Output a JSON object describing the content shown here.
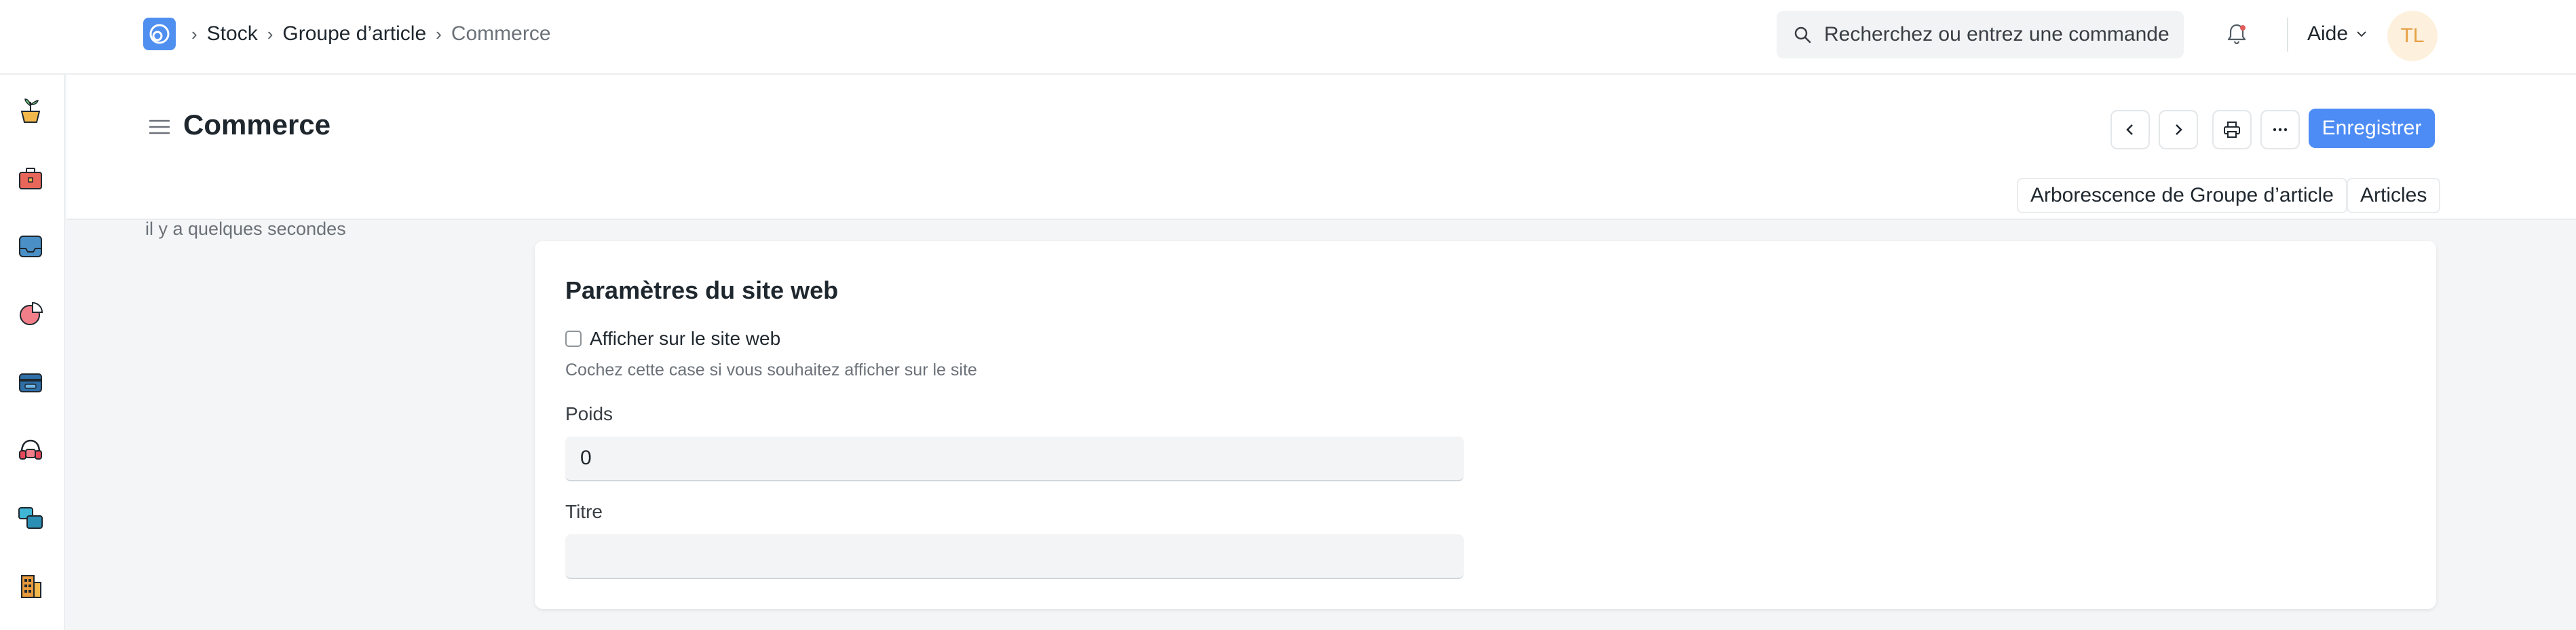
{
  "navbar": {
    "logo": "app-logo",
    "breadcrumb": [
      "Stock",
      "Groupe d’article",
      "Commerce"
    ],
    "search_placeholder": "Recherchez ou entrez une commande",
    "help_label": "Aide",
    "avatar_initials": "TL"
  },
  "sidebar": {
    "icons": [
      "plant-icon",
      "toolbox-icon",
      "inbox-icon",
      "pie-chart-icon",
      "wallet-icon",
      "headset-icon",
      "stack-icon",
      "building-icon"
    ]
  },
  "page": {
    "title": "Commerce",
    "save_label": "Enregistrer",
    "links": [
      "Arborescence de Groupe d’article",
      "Articles"
    ],
    "timestamp": "il y a quelques secondes"
  },
  "section": {
    "title": "Paramètres du site web",
    "checkbox_label": "Afficher sur le site web",
    "checkbox_checked": false,
    "checkbox_description": "Cochez cette case si vous souhaitez afficher sur le site",
    "fields": [
      {
        "label": "Poids",
        "value": "0"
      },
      {
        "label": "Titre",
        "value": ""
      }
    ]
  },
  "colors": {
    "primary": "#4d8cf5",
    "avatar_bg": "#fdf0dc",
    "avatar_fg": "#e6a045"
  }
}
